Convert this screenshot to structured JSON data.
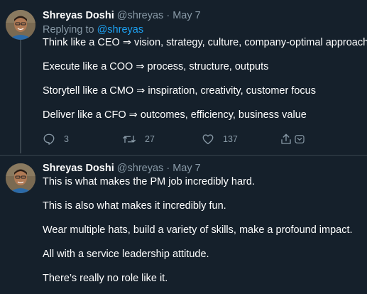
{
  "tweet1": {
    "name": "Shreyas Doshi",
    "handle": "@shreyas",
    "separator": "·",
    "date": "May 7",
    "replying_label": "Replying to",
    "replying_to": "@shreyas",
    "lines": [
      "Think like a CEO ⇒ vision, strategy, culture, company-optimal approach",
      "Execute like a COO ⇒ process, structure, outputs",
      "Storytell like a CMO ⇒ inspiration, creativity, customer focus",
      "Deliver like a CFO ⇒ outcomes, efficiency, business value"
    ],
    "actions": {
      "reply_count": "3",
      "retweet_count": "27",
      "like_count": "137",
      "reply_icon": "reply-icon",
      "retweet_icon": "retweet-icon",
      "like_icon": "heart-icon",
      "share_icon": "share-icon",
      "more_icon": "chevron-down-icon"
    }
  },
  "tweet2": {
    "name": "Shreyas Doshi",
    "handle": "@shreyas",
    "separator": "·",
    "date": "May 7",
    "lines": [
      "This is what makes the PM job incredibly hard.",
      "This is also what makes it incredibly fun.",
      "Wear multiple hats, build a variety of skills, make a profound impact.",
      "All with a service leadership attitude.",
      "There’s really no role like it."
    ]
  },
  "colors": {
    "background": "#15202b",
    "secondary_text": "#8899a6",
    "link": "#1da1f2",
    "border": "#38444d"
  }
}
